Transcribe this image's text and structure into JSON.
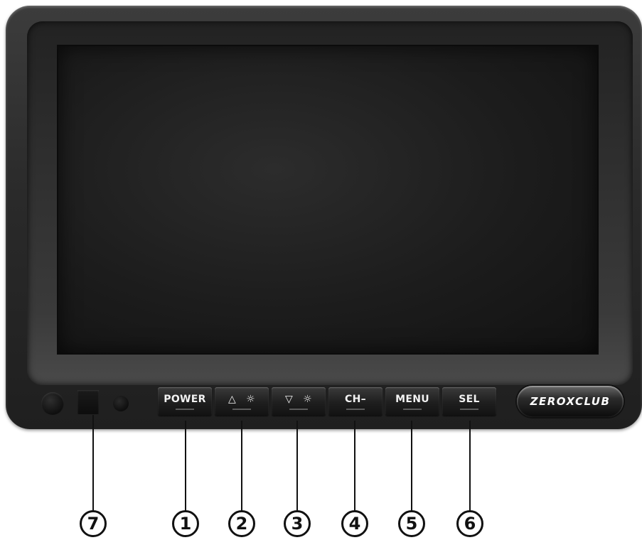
{
  "buttons": [
    {
      "id": "power",
      "label": "POWER"
    },
    {
      "id": "up",
      "label": "△",
      "icon": "brightness-sun-icon"
    },
    {
      "id": "down",
      "label": "▽",
      "icon": "brightness-sun-icon"
    },
    {
      "id": "ch",
      "label": "CH–"
    },
    {
      "id": "menu",
      "label": "MENU"
    },
    {
      "id": "sel",
      "label": "SEL"
    }
  ],
  "sun_glyph": "☼",
  "logo": {
    "text": "ZEROXCLUB"
  },
  "callouts": [
    "1",
    "2",
    "3",
    "4",
    "5",
    "6",
    "7"
  ],
  "colors": {
    "body": "#2a2a2a",
    "screen": "#1c1c1c",
    "callout": "#111111"
  }
}
